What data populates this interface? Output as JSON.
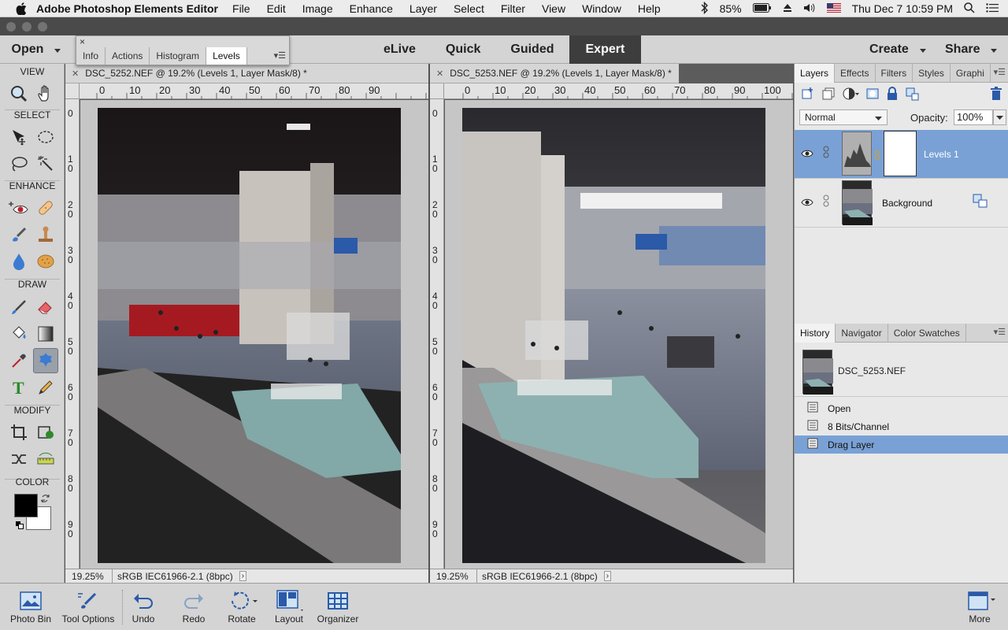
{
  "macmenu": {
    "app_name": "Adobe Photoshop Elements Editor",
    "items": [
      "File",
      "Edit",
      "Image",
      "Enhance",
      "Layer",
      "Select",
      "Filter",
      "View",
      "Window",
      "Help"
    ],
    "battery": "85%",
    "clock": "Thu Dec 7  10:59 PM"
  },
  "appbar": {
    "open_label": "Open",
    "modes": [
      "eLive",
      "Quick",
      "Guided",
      "Expert"
    ],
    "active_mode": "Expert",
    "create_label": "Create",
    "share_label": "Share"
  },
  "float_panel": {
    "tabs": [
      "Info",
      "Actions",
      "Histogram",
      "Levels"
    ],
    "active_tab": "Levels"
  },
  "toolbox": {
    "sections": [
      "VIEW",
      "SELECT",
      "ENHANCE",
      "DRAW",
      "MODIFY",
      "COLOR"
    ],
    "colors": {
      "foreground": "#000000",
      "background": "#ffffff"
    }
  },
  "documents": [
    {
      "tab_title": "DSC_5252.NEF @ 19.2% (Levels 1, Layer Mask/8) *",
      "zoom": "19.25%",
      "profile": "sRGB IEC61966-2.1 (8bpc)",
      "ruler_h": [
        "0",
        "10",
        "20",
        "30",
        "40",
        "50",
        "60",
        "70",
        "80",
        "90"
      ],
      "ruler_v": [
        "0",
        "1\n0",
        "2\n0",
        "3\n0",
        "4\n0",
        "5\n0",
        "6\n0",
        "7\n0",
        "8\n0",
        "9\n0"
      ]
    },
    {
      "tab_title": "DSC_5253.NEF @ 19.2% (Levels 1, Layer Mask/8) *",
      "zoom": "19.25%",
      "profile": "sRGB IEC61966-2.1 (8bpc)",
      "ruler_h": [
        "0",
        "10",
        "20",
        "30",
        "40",
        "50",
        "60",
        "70",
        "80",
        "90",
        "100"
      ],
      "ruler_v": [
        "0",
        "1\n0",
        "2\n0",
        "3\n0",
        "4\n0",
        "5\n0",
        "6\n0",
        "7\n0",
        "8\n0",
        "9\n0"
      ]
    }
  ],
  "layers_panel": {
    "tabs": [
      "Layers",
      "Effects",
      "Filters",
      "Styles",
      "Graphi"
    ],
    "active_tab": "Layers",
    "blend_mode": "Normal",
    "opacity_label": "Opacity:",
    "opacity_value": "100%",
    "layers": [
      {
        "name": "Levels 1",
        "selected": true
      },
      {
        "name": "Background",
        "selected": false
      }
    ]
  },
  "history_panel": {
    "tabs": [
      "History",
      "Navigator",
      "Color Swatches"
    ],
    "active_tab": "History",
    "document": "DSC_5253.NEF",
    "steps": [
      "Open",
      "8 Bits/Channel",
      "Drag Layer"
    ],
    "selected_step": "Drag Layer"
  },
  "bottom_bar": {
    "photo_bin": "Photo Bin",
    "tool_options": "Tool Options",
    "undo": "Undo",
    "redo": "Redo",
    "rotate": "Rotate",
    "layout": "Layout",
    "organizer": "Organizer",
    "more": "More"
  },
  "accent_colors": {
    "selection": "#7aa1d5",
    "expert_tab": "#3d3d3d"
  }
}
